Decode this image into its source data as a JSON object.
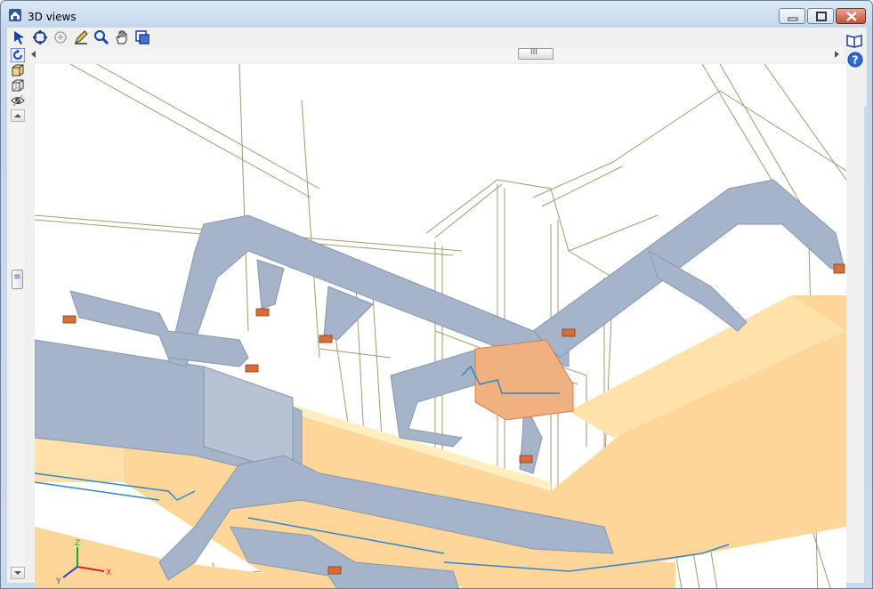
{
  "window": {
    "title": "3D views",
    "app_icon": "3d-views-app-icon",
    "controls": [
      "minimize-icon",
      "maximize-icon",
      "close-icon"
    ]
  },
  "toolbar": {
    "icons": [
      "select-arrow-icon",
      "zoom-extents-icon",
      "zoom-previous-icon",
      "draw-pencil-icon",
      "zoom-window-icon",
      "pan-hand-icon",
      "view-layers-icon"
    ]
  },
  "vertical_tools": {
    "icons": [
      "orbit-rotate-icon",
      "solid-box-icon",
      "wireframe-box-icon",
      "eye-view-icon"
    ]
  },
  "right_panel": {
    "icons": [
      "book-icon",
      "help-icon"
    ]
  },
  "scrollbars": {
    "horizontal_thumb_grip": "III",
    "vertical_thumb_grip": "≡"
  },
  "axes": {
    "x_label": "X",
    "y_label": "Y",
    "z_label": "Z",
    "x_color": "#e0202a",
    "y_color": "#2a3fd0",
    "z_color": "#19a33a"
  },
  "colors": {
    "duct": "#a5b4c8",
    "slab": "#ffd699",
    "grille": "#d76e3a",
    "wire": "#a09a70",
    "pipe": "#2f86c8"
  }
}
